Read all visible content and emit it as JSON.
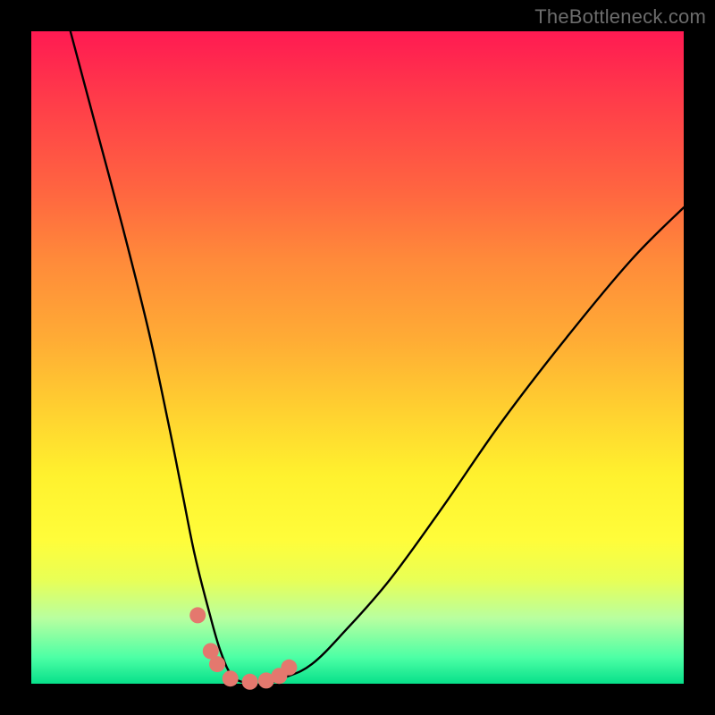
{
  "watermark": "TheBottleneck.com",
  "chart_data": {
    "type": "line",
    "title": "",
    "xlabel": "",
    "ylabel": "",
    "xlim": [
      0,
      100
    ],
    "ylim": [
      0,
      100
    ],
    "series": [
      {
        "name": "bottleneck-curve",
        "x": [
          6,
          10,
          14,
          18,
          21,
          23,
          25,
          27,
          29,
          31,
          34,
          36,
          39,
          43,
          48,
          55,
          63,
          72,
          82,
          92,
          100
        ],
        "values": [
          100,
          85,
          70,
          54,
          40,
          30,
          20,
          12,
          5,
          1,
          0,
          0,
          1,
          3,
          8,
          16,
          27,
          40,
          53,
          65,
          73
        ]
      }
    ],
    "markers": {
      "name": "highlight-points",
      "x": [
        25.5,
        27.5,
        28.5,
        30.5,
        33.5,
        36.0,
        38.0,
        39.5
      ],
      "values": [
        10.5,
        5.0,
        3.0,
        0.8,
        0.3,
        0.5,
        1.2,
        2.5
      ]
    },
    "gradient_bands": [
      {
        "stop": 0,
        "color": "#ff1a52"
      },
      {
        "stop": 25,
        "color": "#ff6740"
      },
      {
        "stop": 50,
        "color": "#ffc030"
      },
      {
        "stop": 75,
        "color": "#fff12e"
      },
      {
        "stop": 95,
        "color": "#4cffa5"
      },
      {
        "stop": 100,
        "color": "#07e08a"
      }
    ]
  }
}
